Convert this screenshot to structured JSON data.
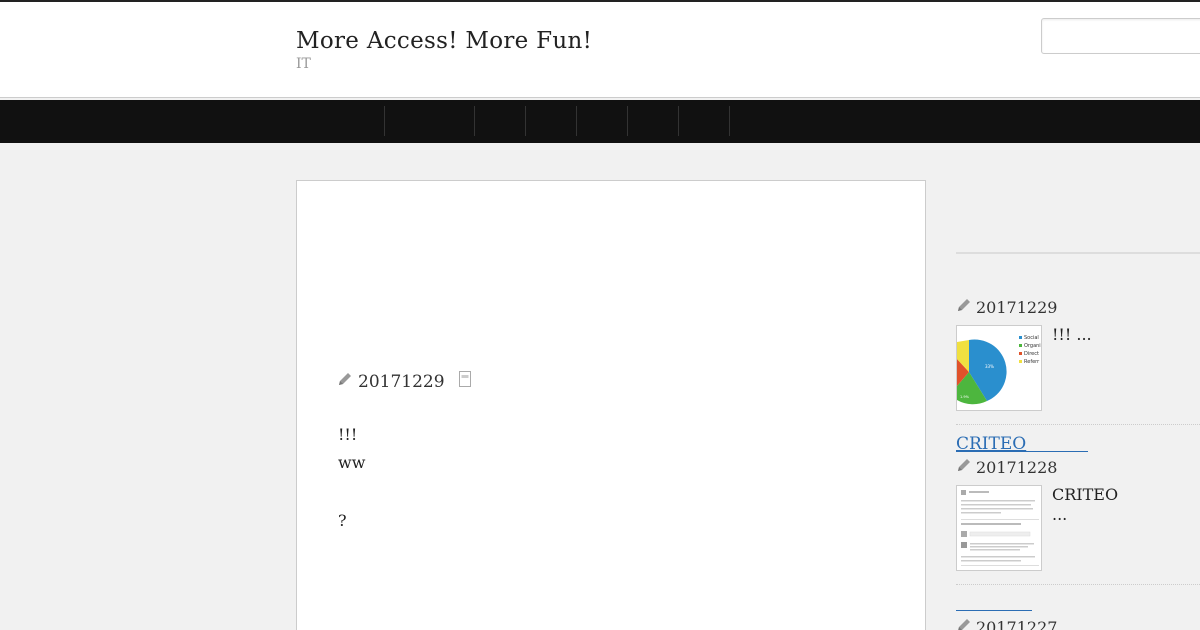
{
  "site": {
    "title": "More Access! More Fun!",
    "description": "IT"
  },
  "search": {
    "placeholder": ""
  },
  "post": {
    "date": "20171229",
    "lines": [
      "!!!",
      "ww",
      "?"
    ]
  },
  "sidebar": {
    "entries": [
      {
        "date": "20171229",
        "excerpt": "!!! ...",
        "thumb_legend": [
          "Social",
          "Organi",
          "Direct",
          "Referr"
        ]
      },
      {
        "title": "CRITEO",
        "date": "20171228",
        "excerpt_line1": "CRITEO",
        "excerpt_line2": "..."
      },
      {
        "date": "20171227"
      }
    ]
  },
  "colors": {
    "link": "#2b6db4",
    "navbar": "#111111",
    "pie_social": "#2a8fce",
    "pie_organic": "#4db63e",
    "pie_direct": "#e0522a",
    "pie_referral": "#f0e040"
  }
}
